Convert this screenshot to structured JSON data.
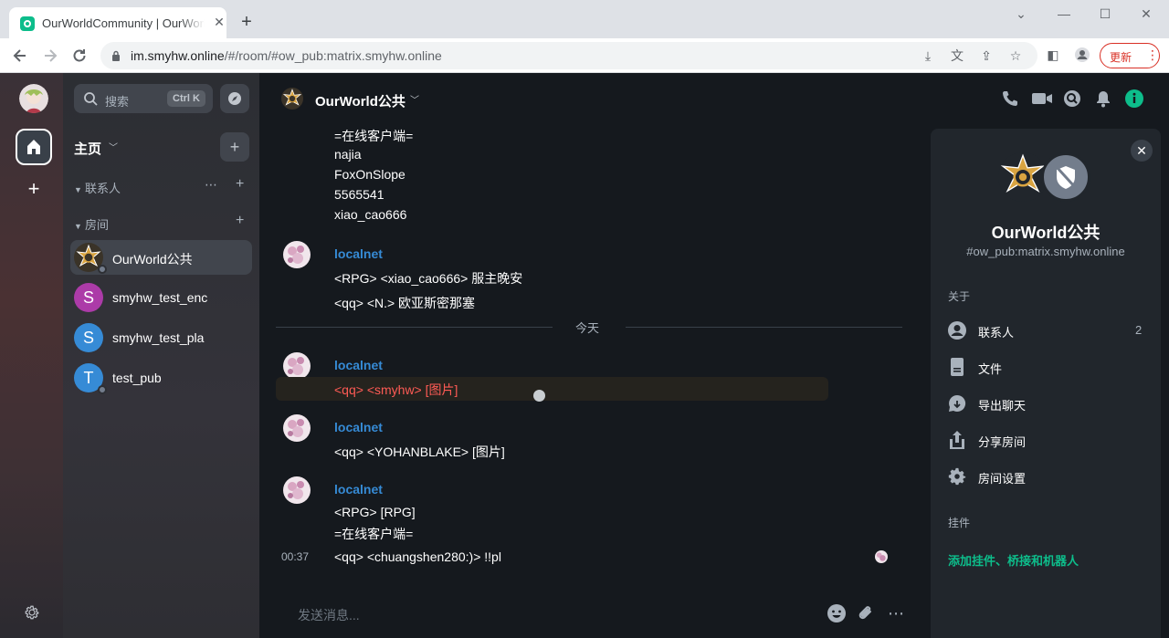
{
  "browser": {
    "tab_title": "OurWorldCommunity | OurWorld",
    "url_host": "im.smyhw.online",
    "url_path": "/#/room/#ow_pub:matrix.smyhw.online",
    "update_label": "更新"
  },
  "sidebar": {
    "search_placeholder": "搜索",
    "search_shortcut": "Ctrl K",
    "home_title": "主页",
    "sections": {
      "people": "联系人",
      "rooms": "房间"
    },
    "rooms": [
      {
        "name": "OurWorld公共",
        "initial": "",
        "color": "#d9a441"
      },
      {
        "name": "smyhw_test_enc",
        "initial": "S",
        "color": "#ac3ba8"
      },
      {
        "name": "smyhw_test_pla",
        "initial": "S",
        "color": "#368bd6"
      },
      {
        "name": "test_pub",
        "initial": "T",
        "color": "#368bd6"
      }
    ]
  },
  "header": {
    "room_name": "OurWorld公共"
  },
  "timeline": {
    "top_lines": [
      "=在线客户端=",
      "najia",
      "FoxOnSlope",
      "5565541",
      "xiao_cao666"
    ],
    "day_separator": "今天",
    "messages": [
      {
        "sender": "localnet",
        "lines": [
          "<RPG> <xiao_cao666> 服主晚安",
          "<qq> <N.> 欧亚斯密那塞"
        ]
      },
      {
        "sender": "localnet",
        "lines": [
          "<qq> <smyhw> [图片]"
        ]
      },
      {
        "sender": "localnet",
        "lines": [
          "<qq> <YOHANBLAKE> [图片]"
        ]
      },
      {
        "sender": "localnet",
        "lines": [
          "<RPG> [RPG]",
          "=在线客户端=",
          "<qq> <chuangshen280:)> !!pl"
        ]
      }
    ],
    "last_timestamp": "00:37"
  },
  "composer": {
    "placeholder": "发送消息..."
  },
  "right_panel": {
    "room_name": "OurWorld公共",
    "alias": "#ow_pub:matrix.smyhw.online",
    "about_label": "关于",
    "items": [
      {
        "label": "联系人",
        "count": "2"
      },
      {
        "label": "文件"
      },
      {
        "label": "导出聊天"
      },
      {
        "label": "分享房间"
      },
      {
        "label": "房间设置"
      }
    ],
    "widgets_label": "挂件",
    "add_widgets_label": "添加挂件、桥接和机器人"
  },
  "colors": {
    "accent": "#0dbd8b",
    "sender": "#368bd6",
    "highlight_text": "#ff5b55"
  }
}
